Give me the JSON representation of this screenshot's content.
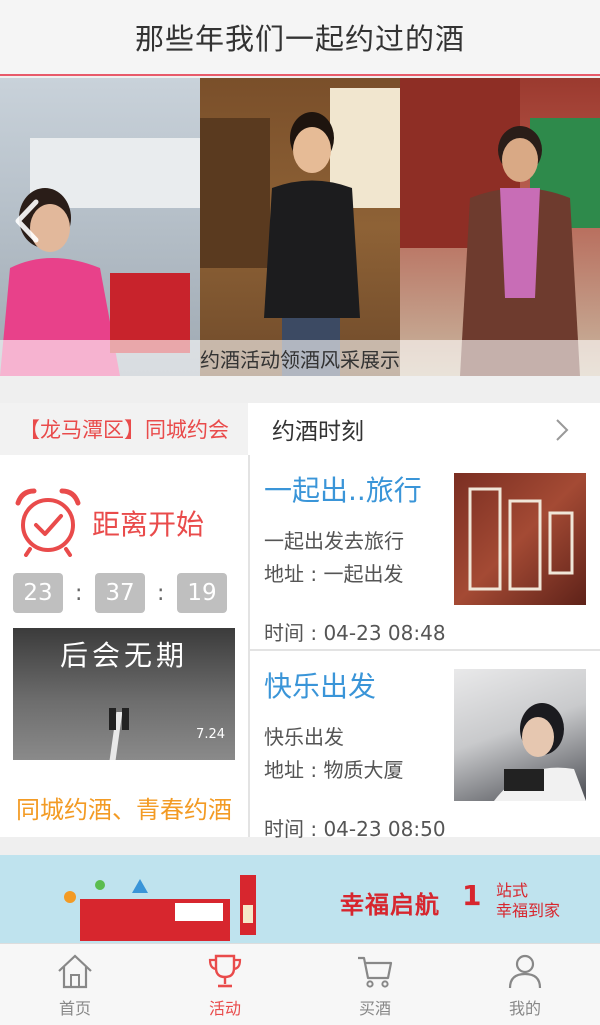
{
  "header": {
    "title": "那些年我们一起约过的酒"
  },
  "banner": {
    "caption": "约酒活动领酒风采展示"
  },
  "panel": {
    "left_header": "【龙马潭区】同城约会",
    "right_header": "约酒时刻",
    "countdown_label": "距离开始",
    "countdown": {
      "hours": "23",
      "minutes": "37",
      "seconds": "19",
      "separator": ":"
    },
    "poster": {
      "title": "后会无期",
      "date": "7.24"
    },
    "slogan": "同城约酒、青春约酒"
  },
  "events": [
    {
      "title": "一起出..旅行",
      "desc": "一起出发去旅行",
      "address": "地址 : 一起出发",
      "time": "时间 : 04-23 08:48"
    },
    {
      "title": "快乐出发",
      "desc": "快乐出发",
      "address": "地址 : 物质大厦",
      "time": "时间 : 04-23 08:50"
    }
  ],
  "ad": {
    "brand": "幸福启航",
    "one": "1",
    "sub_line1": "站式",
    "sub_line2": "幸福到家"
  },
  "tabbar": {
    "items": [
      {
        "label": "首页",
        "icon": "home-icon"
      },
      {
        "label": "活动",
        "icon": "trophy-icon"
      },
      {
        "label": "买酒",
        "icon": "cart-icon"
      },
      {
        "label": "我的",
        "icon": "user-icon"
      }
    ],
    "active_index": 1
  },
  "colors": {
    "accent_red": "#e94b4b",
    "link_blue": "#3a95d8",
    "slogan_orange": "#f39b24"
  }
}
